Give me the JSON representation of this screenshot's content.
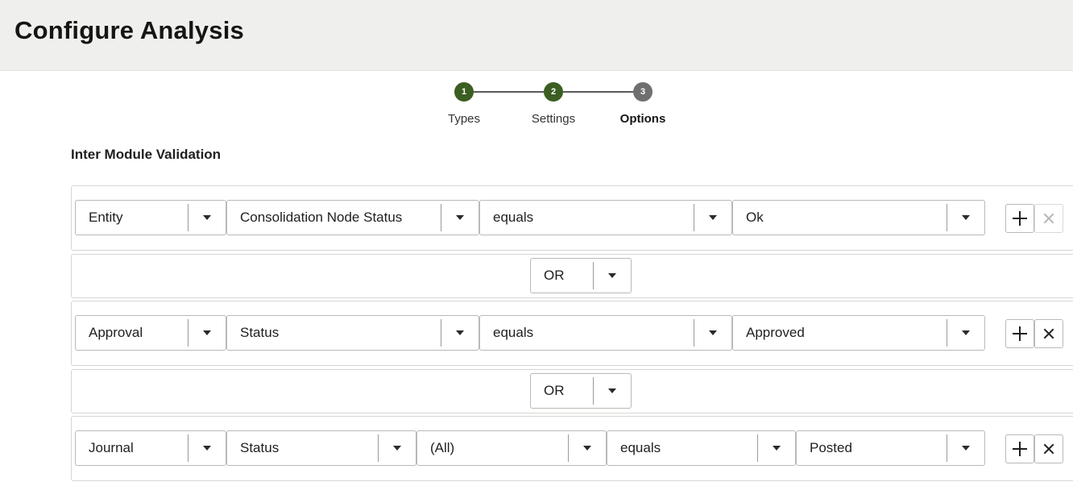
{
  "header": {
    "title": "Configure Analysis"
  },
  "stepper": {
    "steps": [
      {
        "number": "1",
        "label": "Types",
        "state": "completed"
      },
      {
        "number": "2",
        "label": "Settings",
        "state": "completed"
      },
      {
        "number": "3",
        "label": "Options",
        "state": "current"
      }
    ]
  },
  "section": {
    "title": "Inter Module Validation"
  },
  "conditions": [
    {
      "fields": [
        "Entity",
        "Consolidation Node Status",
        "equals",
        "Ok"
      ],
      "remove_enabled": false
    },
    {
      "fields": [
        "Approval",
        "Status",
        "equals",
        "Approved"
      ],
      "remove_enabled": true
    },
    {
      "fields": [
        "Journal",
        "Status",
        "(All)",
        "equals",
        "Posted"
      ],
      "remove_enabled": true
    }
  ],
  "connectors": [
    {
      "value": "OR"
    },
    {
      "value": "OR"
    }
  ],
  "colors": {
    "step_done": "#3b5e21",
    "step_current": "#6f6f6f",
    "header_bg": "#efefed"
  },
  "icons": {
    "add": "plus-icon",
    "remove": "close-icon",
    "dropdown": "caret-down-icon"
  }
}
